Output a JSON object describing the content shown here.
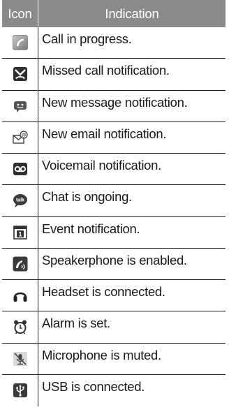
{
  "table": {
    "headers": {
      "icon": "Icon",
      "indication": "Indication"
    },
    "rows": [
      {
        "icon": "call-in-progress-icon",
        "label": "Call in progress."
      },
      {
        "icon": "missed-call-icon",
        "label": "Missed call notification."
      },
      {
        "icon": "new-message-icon",
        "label": "New message notification."
      },
      {
        "icon": "new-email-icon",
        "label": "New email notification."
      },
      {
        "icon": "voicemail-icon",
        "label": "Voicemail notification."
      },
      {
        "icon": "talk-chat-icon",
        "label": "Chat is ongoing."
      },
      {
        "icon": "event-calendar-icon",
        "label": "Event notification."
      },
      {
        "icon": "speakerphone-icon",
        "label": "Speakerphone is enabled."
      },
      {
        "icon": "headset-icon",
        "label": "Headset is connected."
      },
      {
        "icon": "alarm-clock-icon",
        "label": "Alarm is set."
      },
      {
        "icon": "microphone-muted-icon",
        "label": "Microphone is muted."
      },
      {
        "icon": "usb-icon",
        "label": "USB is connected."
      }
    ]
  }
}
